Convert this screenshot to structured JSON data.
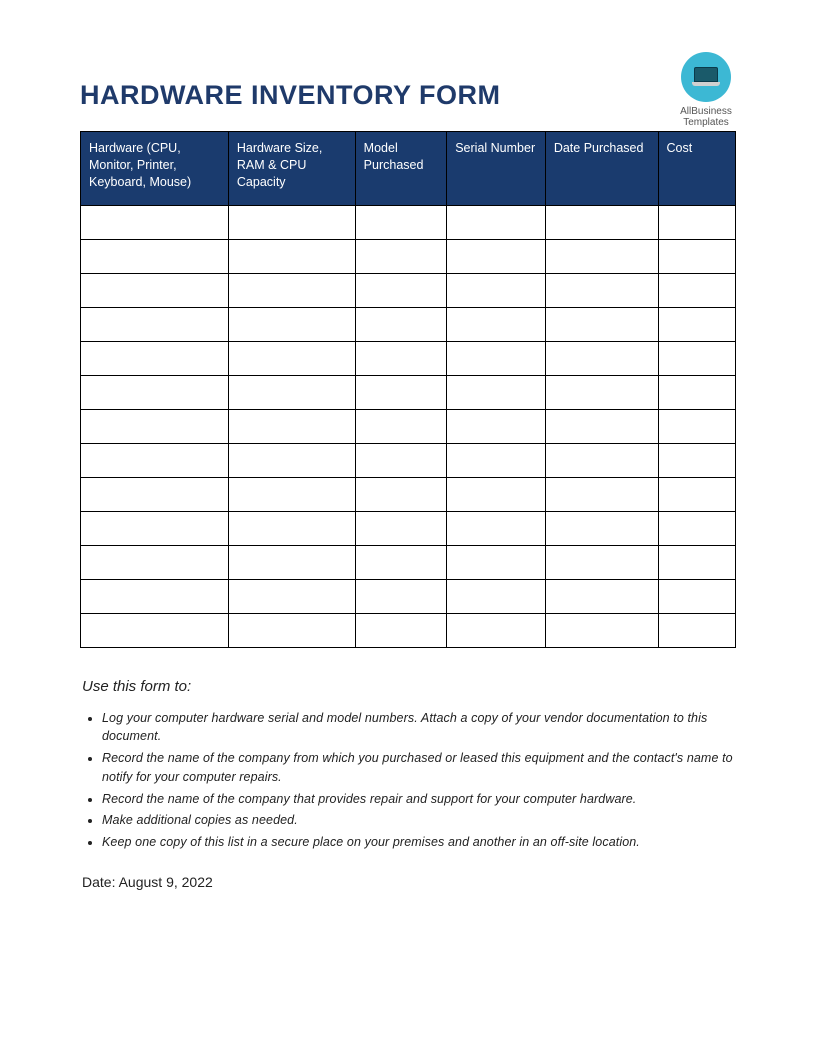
{
  "title": "HARDWARE INVENTORY FORM",
  "logo": {
    "line1": "AllBusiness",
    "line2": "Templates"
  },
  "table": {
    "headers": [
      "Hardware (CPU, Monitor, Printer, Keyboard, Mouse)",
      "Hardware Size, RAM & CPU Capacity",
      "Model Purchased",
      "Serial Number",
      "Date Purchased",
      "Cost"
    ],
    "row_count": 13
  },
  "instructions_title": "Use this form to:",
  "instructions": [
    "Log your computer hardware serial and model numbers. Attach a copy of your vendor documentation to this document.",
    "Record the name of the company from which you purchased or leased this equipment and the contact's name to notify for your computer repairs.",
    "Record the name of the company that provides repair and support for your computer hardware.",
    "Make additional copies as needed.",
    "Keep one copy of this list in a secure place on your premises and another in an off-site location."
  ],
  "date_label": "Date:",
  "date_value": "August 9, 2022"
}
